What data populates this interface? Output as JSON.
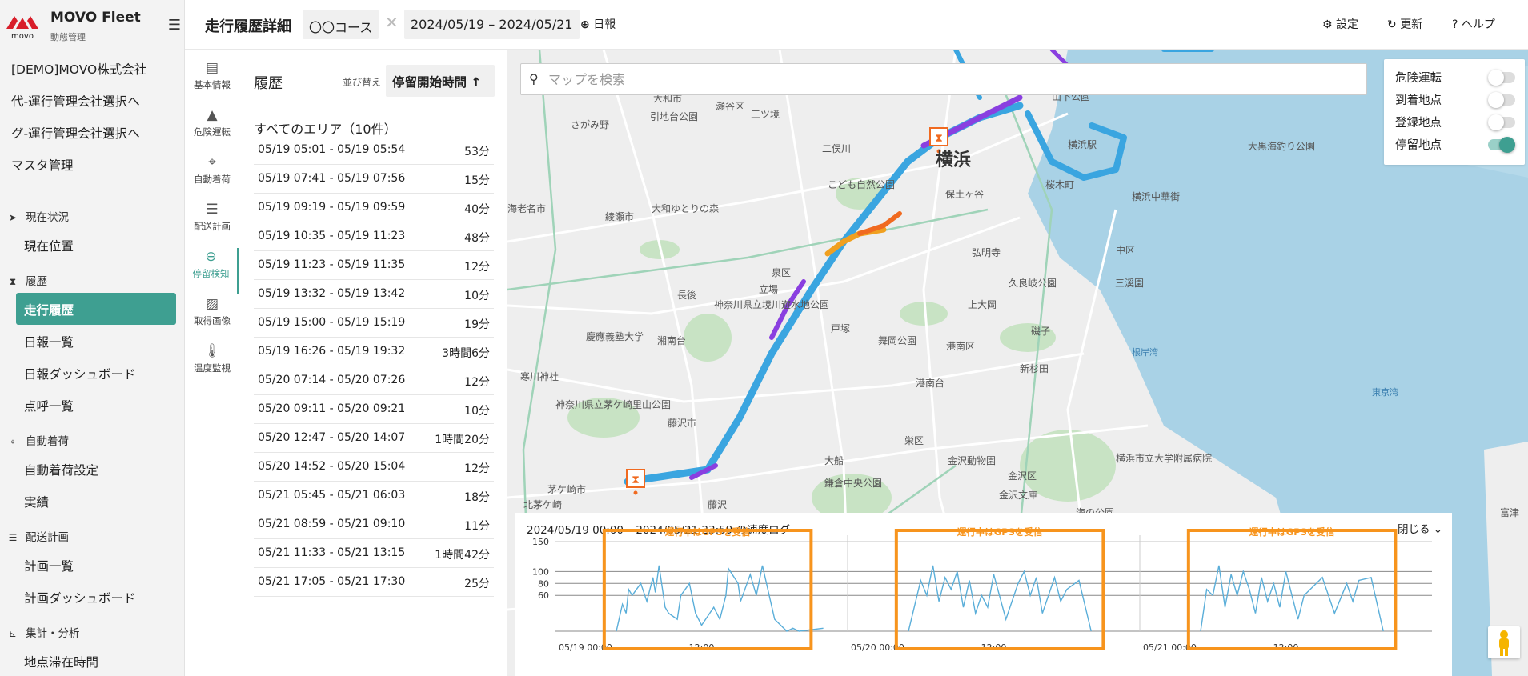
{
  "app": {
    "brand": "MOVO Fleet",
    "brand_sub": "動態管理",
    "logo_text": "movo"
  },
  "sidebar": {
    "company": "[DEMO]MOVO株式会社",
    "links": [
      "代-運行管理会社選択へ",
      "グ-運行管理会社選択へ",
      "マスタ管理"
    ],
    "sections": [
      {
        "title": "現在状況",
        "icon": "navigation-arrow-icon",
        "items": [
          "現在位置"
        ]
      },
      {
        "title": "履歴",
        "icon": "hourglass-icon",
        "items": [
          "走行履歴",
          "日報一覧",
          "日報ダッシュボード",
          "点呼一覧"
        ],
        "active": "走行履歴"
      },
      {
        "title": "自動着荷",
        "icon": "crosshair-icon",
        "items": [
          "自動着荷設定",
          "実績"
        ]
      },
      {
        "title": "配送計画",
        "icon": "list-icon",
        "items": [
          "計画一覧",
          "計画ダッシュボード"
        ]
      },
      {
        "title": "集計・分析",
        "icon": "chart-icon",
        "items": [
          "地点滞在時間"
        ]
      }
    ]
  },
  "header": {
    "title": "走行履歴詳細",
    "course": "〇〇コース",
    "date_range": "2024/05/19 – 2024/05/21",
    "nippo": "日報",
    "settings": "設定",
    "refresh": "更新",
    "help": "ヘルプ"
  },
  "tools": [
    {
      "label": "基本情報",
      "icon": "document-icon"
    },
    {
      "label": "危険運転",
      "icon": "warning-icon"
    },
    {
      "label": "自動着荷",
      "icon": "crosshair-icon"
    },
    {
      "label": "配送計画",
      "icon": "list-icon"
    },
    {
      "label": "停留検知",
      "icon": "minus-circle-icon",
      "active": true
    },
    {
      "label": "取得画像",
      "icon": "image-icon"
    },
    {
      "label": "温度監視",
      "icon": "thermometer-icon"
    }
  ],
  "history": {
    "title": "履歴",
    "sort_label": "並び替え",
    "sort_value": "停留開始時間",
    "area_title": "すべてのエリア（10件）",
    "rows": [
      {
        "time": "05/19 05:01 - 05/19 05:54",
        "duration": "53分"
      },
      {
        "time": "05/19 07:41 - 05/19 07:56",
        "duration": "15分"
      },
      {
        "time": "05/19 09:19 - 05/19 09:59",
        "duration": "40分"
      },
      {
        "time": "05/19 10:35 - 05/19 11:23",
        "duration": "48分"
      },
      {
        "time": "05/19 11:23 - 05/19 11:35",
        "duration": "12分"
      },
      {
        "time": "05/19 13:32 - 05/19 13:42",
        "duration": "10分"
      },
      {
        "time": "05/19 15:00 - 05/19 15:19",
        "duration": "19分"
      },
      {
        "time": "05/19 16:26 - 05/19 19:32",
        "duration": "3時間6分"
      },
      {
        "time": "05/20 07:14 - 05/20 07:26",
        "duration": "12分"
      },
      {
        "time": "05/20 09:11 - 05/20 09:21",
        "duration": "10分"
      },
      {
        "time": "05/20 12:47 - 05/20 14:07",
        "duration": "1時間20分"
      },
      {
        "time": "05/20 14:52 - 05/20 15:04",
        "duration": "12分"
      },
      {
        "time": "05/21 05:45 - 05/21 06:03",
        "duration": "18分"
      },
      {
        "time": "05/21 08:59 - 05/21 09:10",
        "duration": "11分"
      },
      {
        "time": "05/21 11:33 - 05/21 13:15",
        "duration": "1時間42分"
      },
      {
        "time": "05/21 17:05 - 05/21 17:30",
        "duration": "25分"
      }
    ]
  },
  "map": {
    "search_placeholder": "マップを検索",
    "layers": [
      {
        "label": "危険運転",
        "on": false
      },
      {
        "label": "到着地点",
        "on": false
      },
      {
        "label": "登録地点",
        "on": false
      },
      {
        "label": "停留地点",
        "on": true
      }
    ],
    "labels": [
      "横浜",
      "大和市",
      "引地台公園",
      "瀬谷区",
      "三ツ境",
      "さがみ野",
      "綾瀬市",
      "大和ゆとりの森",
      "二俣川",
      "こども自然公園",
      "保土ヶ谷",
      "桜木町",
      "横浜中華街",
      "中区",
      "山下公園",
      "大黒海釣り公園",
      "泉区",
      "立場",
      "長後",
      "神奈川県立境川遊水地公園",
      "慶應義塾大学",
      "湘南台",
      "戸塚",
      "舞岡公園",
      "上大岡",
      "港南区",
      "弘明寺",
      "久良岐公園",
      "磯子",
      "新杉田",
      "三溪園",
      "寒川神社",
      "神奈川県立茅ケ崎里山公園",
      "藤沢市",
      "港南台",
      "栄区",
      "大船",
      "鎌倉中央公園",
      "金沢動物園",
      "金沢区",
      "金沢文庫",
      "横浜市立大学附属病院",
      "茅ケ崎市",
      "藤沢",
      "北茅ケ崎",
      "海老名市",
      "根岸湾",
      "東京湾",
      "富津",
      "海の公園",
      "横浜駅"
    ],
    "accent": "#3e9f91",
    "route_colors": [
      "#3aa5e0",
      "#8a3fe0",
      "#f0a020",
      "#f06a20"
    ]
  },
  "speed_log": {
    "title": "2024/05/19 00:00 – 2024/05/21 23:59 の速度ログ",
    "close_label": "閉じる",
    "gps_label": "運行中はGPSを受信",
    "box_color": "#f7941d",
    "line_color": "#5aaed9"
  },
  "chart_data": {
    "type": "line",
    "title": "",
    "xlabel": "",
    "ylabel": "",
    "y_ticks": [
      60,
      80,
      100,
      150
    ],
    "ylim": [
      0,
      150
    ],
    "x_tick_labels": [
      "05/19 00:00",
      "12:00",
      "05/20 00:00",
      "12:00",
      "05/21 00:00",
      "12:00"
    ],
    "series": [
      {
        "day": "05/19",
        "x_hours": [
          5,
          5.5,
          5.8,
          6,
          6.3,
          7,
          7.5,
          8,
          8.2,
          8.5,
          9,
          9.3,
          10,
          10.3,
          11,
          11.5,
          12,
          13,
          13.5,
          14,
          14.2,
          15,
          15.2,
          16,
          16.5,
          17,
          18,
          19,
          19.5,
          20,
          22
        ],
        "values": [
          0,
          45,
          30,
          70,
          60,
          80,
          50,
          90,
          65,
          110,
          40,
          30,
          20,
          60,
          80,
          30,
          10,
          40,
          20,
          60,
          105,
          80,
          50,
          95,
          60,
          110,
          20,
          0,
          5,
          0,
          5
        ]
      },
      {
        "day": "05/20",
        "x_hours": [
          5,
          6,
          6.5,
          7,
          7.5,
          8,
          8.5,
          9,
          9.5,
          10,
          10.5,
          11,
          11.5,
          12,
          13,
          14,
          14.5,
          15,
          15.5,
          16,
          17,
          17.5,
          18,
          19,
          20
        ],
        "values": [
          0,
          85,
          60,
          110,
          50,
          90,
          70,
          100,
          40,
          85,
          30,
          60,
          40,
          95,
          20,
          80,
          100,
          60,
          90,
          30,
          90,
          50,
          70,
          85,
          0
        ]
      },
      {
        "day": "05/21",
        "x_hours": [
          5,
          5.5,
          6,
          6.5,
          7,
          7.5,
          8,
          8.5,
          9,
          9.5,
          10,
          10.5,
          11,
          11.5,
          12,
          13,
          13.5,
          14,
          15,
          16,
          17,
          17.5,
          18,
          19,
          20
        ],
        "values": [
          0,
          70,
          60,
          110,
          40,
          95,
          60,
          100,
          70,
          30,
          90,
          50,
          80,
          40,
          100,
          20,
          60,
          70,
          90,
          30,
          80,
          50,
          85,
          90,
          0
        ]
      }
    ]
  }
}
